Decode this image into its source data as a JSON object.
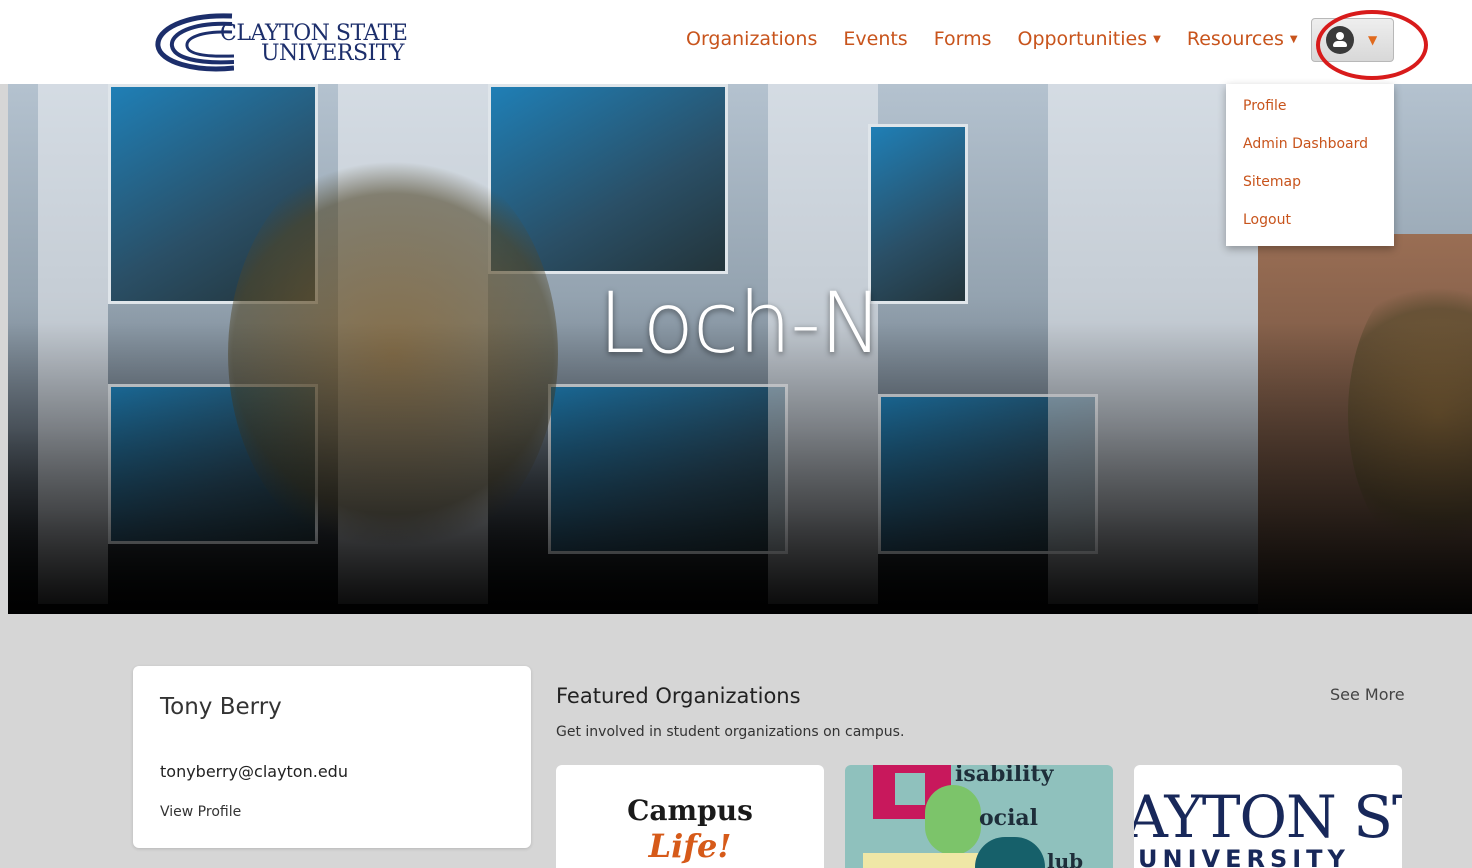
{
  "brand": {
    "line1": "CLAYTON STATE",
    "line2": "UNIVERSITY",
    "primary_color": "#1c2e6b",
    "accent_color": "#c8541c"
  },
  "nav": {
    "organizations": "Organizations",
    "events": "Events",
    "forms": "Forms",
    "opportunities": "Opportunities",
    "resources": "Resources"
  },
  "user_menu": {
    "icon": "user-icon",
    "items": [
      "Profile",
      "Admin Dashboard",
      "Sitemap",
      "Logout"
    ]
  },
  "hero": {
    "title": "Loch-N"
  },
  "profile": {
    "name": "Tony Berry",
    "email": "tonyberry@clayton.edu",
    "view_link": "View Profile"
  },
  "featured": {
    "title": "Featured Organizations",
    "subtitle": "Get involved in student organizations on campus.",
    "see_more": "See More",
    "cards": [
      {
        "line1": "Campus",
        "line2": "Life!"
      },
      {
        "word1": "isability",
        "word2": "ocial",
        "word3": "lub"
      },
      {
        "line1": "AYTON ST",
        "line2": "UNIVERSITY"
      }
    ]
  }
}
